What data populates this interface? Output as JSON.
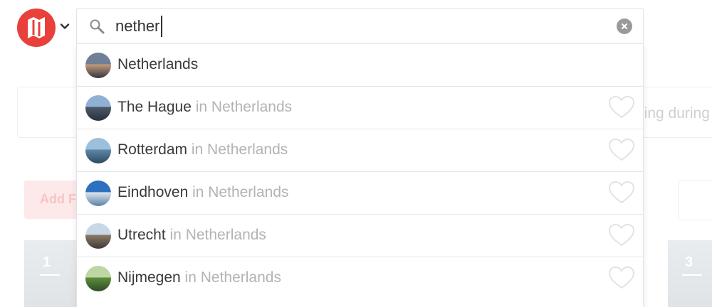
{
  "search": {
    "query": "nether",
    "placeholder": ""
  },
  "background": {
    "hint_fragment": "ling during",
    "add_button_fragment": "Add F",
    "tile_left_number": "1",
    "tile_right_number": "3"
  },
  "results": [
    {
      "name": "Netherlands",
      "suffix": "",
      "favorite_icon": false,
      "thumb_colors": [
        "#6f7f96",
        "#c79b7a",
        "#2f3540"
      ]
    },
    {
      "name": "The Hague",
      "suffix": " in Netherlands",
      "favorite_icon": true,
      "thumb_colors": [
        "#8fb1d3",
        "#4d5a6a",
        "#27303a"
      ]
    },
    {
      "name": "Rotterdam",
      "suffix": " in Netherlands",
      "favorite_icon": true,
      "thumb_colors": [
        "#9cc0dc",
        "#5e88a8",
        "#2b4a62"
      ]
    },
    {
      "name": "Eindhoven",
      "suffix": " in Netherlands",
      "favorite_icon": true,
      "thumb_colors": [
        "#2f6fbf",
        "#dfe6ee",
        "#5a7fa8"
      ]
    },
    {
      "name": "Utrecht",
      "suffix": " in Netherlands",
      "favorite_icon": true,
      "thumb_colors": [
        "#c9d8e6",
        "#8a7a66",
        "#3f3a34"
      ]
    },
    {
      "name": "Nijmegen",
      "suffix": " in Netherlands",
      "favorite_icon": true,
      "thumb_colors": [
        "#bcd7a4",
        "#5f8f3c",
        "#2e4a24"
      ]
    }
  ],
  "colors": {
    "brand": "#e8403b",
    "heart_outline": "#e3e3e3",
    "suffix_text": "#b3b3b3"
  }
}
